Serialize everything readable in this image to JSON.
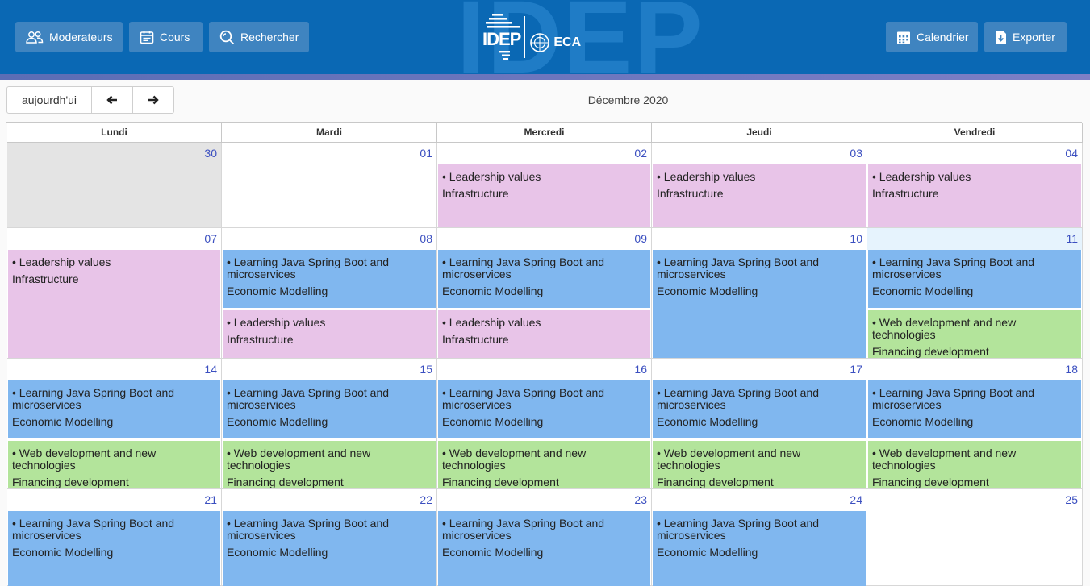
{
  "header": {
    "moderateurs": "Moderateurs",
    "cours": "Cours",
    "rechercher": "Rechercher",
    "calendrier": "Calendrier",
    "exporter": "Exporter",
    "watermark": "IDEP",
    "logo_idep": "IDEP",
    "logo_eca": "ECA"
  },
  "toolbar": {
    "today": "aujourdh'ui",
    "month": "Décembre 2020"
  },
  "colors": {
    "pink": "#e8c4e8",
    "blue": "#80b7ef",
    "green": "#b3e49b",
    "header": "#0a68b4"
  },
  "weekdays": [
    "Lundi",
    "Mardi",
    "Mercredi",
    "Jeudi",
    "Vendredi"
  ],
  "events": {
    "leadership": {
      "title": "• Leadership values",
      "sub": "Infrastructure",
      "color": "pink"
    },
    "java": {
      "title": "• Learning Java Spring Boot and microservices",
      "sub": "Economic Modelling",
      "color": "blue"
    },
    "web": {
      "title": "• Web development and new technologies",
      "sub": "Financing development",
      "color": "green"
    }
  },
  "weeks": [
    [
      {
        "num": "30",
        "other": true,
        "events": []
      },
      {
        "num": "01",
        "events": []
      },
      {
        "num": "02",
        "events": [
          "leadership"
        ]
      },
      {
        "num": "03",
        "events": [
          "leadership"
        ]
      },
      {
        "num": "04",
        "events": [
          "leadership"
        ]
      }
    ],
    [
      {
        "num": "07",
        "events": [
          "leadership"
        ]
      },
      {
        "num": "08",
        "events": [
          "java",
          "leadership"
        ]
      },
      {
        "num": "09",
        "events": [
          "java",
          "leadership"
        ]
      },
      {
        "num": "10",
        "events": [
          "java"
        ]
      },
      {
        "num": "11",
        "today": true,
        "events": [
          "java",
          "web"
        ]
      }
    ],
    [
      {
        "num": "14",
        "events": [
          "java",
          "web"
        ]
      },
      {
        "num": "15",
        "events": [
          "java",
          "web"
        ]
      },
      {
        "num": "16",
        "events": [
          "java",
          "web"
        ]
      },
      {
        "num": "17",
        "events": [
          "java",
          "web"
        ]
      },
      {
        "num": "18",
        "events": [
          "java",
          "web"
        ]
      }
    ],
    [
      {
        "num": "21",
        "events": [
          "java"
        ]
      },
      {
        "num": "22",
        "events": [
          "java"
        ]
      },
      {
        "num": "23",
        "events": [
          "java"
        ]
      },
      {
        "num": "24",
        "events": [
          "java"
        ]
      },
      {
        "num": "25",
        "events": []
      }
    ]
  ]
}
